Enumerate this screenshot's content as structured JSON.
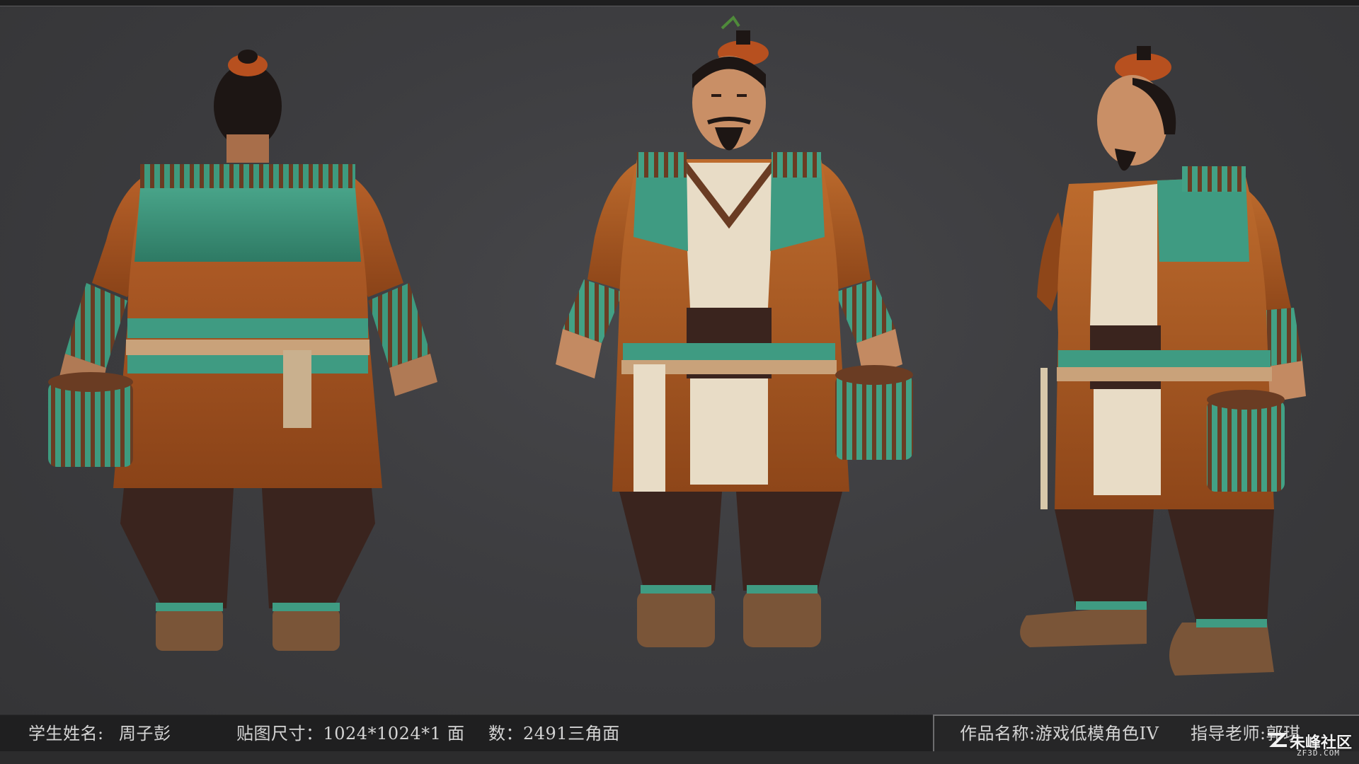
{
  "footer": {
    "student_label": "学生姓名:",
    "student_name": "周子彭",
    "texture_size": "贴图尺寸：1024*1024*1",
    "face_label": "面",
    "face_count": "数：2491三角面",
    "work_title": "作品名称:游戏低模角色IV",
    "teacher": "指导老师:郭琪"
  },
  "watermark": {
    "name": "朱峰社区",
    "url": "ZF3D.COM"
  },
  "colors": {
    "background": "#3d3d40",
    "robe_orange": "#a8561f",
    "robe_green": "#3f9b82",
    "shirt_cream": "#e8dcc6",
    "trousers_brown": "#3a241e",
    "skin": "#c98f66"
  }
}
